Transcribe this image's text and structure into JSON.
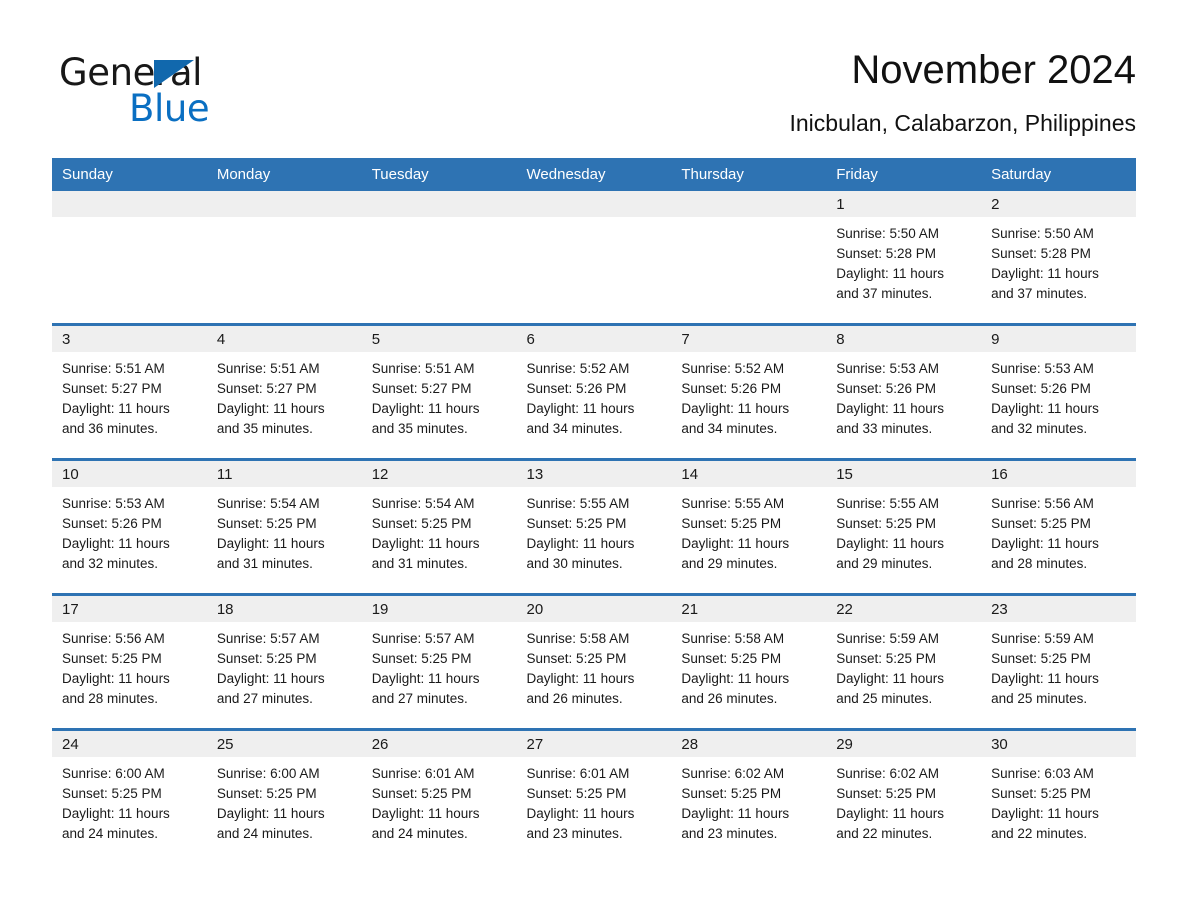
{
  "logo": {
    "word_one": "General",
    "word_two": "Blue",
    "triangle_color": "#1168ad",
    "blue_color": "#0a6fc2"
  },
  "header": {
    "title": "November 2024",
    "subtitle": "Inicbulan, Calabarzon, Philippines"
  },
  "theme": {
    "header_blue": "#2e73b3",
    "row_rule_blue": "#2e73b3",
    "date_band_gray": "#efefef",
    "text_color": "#1a1a1a"
  },
  "weekday_headers": [
    "Sunday",
    "Monday",
    "Tuesday",
    "Wednesday",
    "Thursday",
    "Friday",
    "Saturday"
  ],
  "weeks": [
    [
      {
        "date": "",
        "empty": true
      },
      {
        "date": "",
        "empty": true
      },
      {
        "date": "",
        "empty": true
      },
      {
        "date": "",
        "empty": true
      },
      {
        "date": "",
        "empty": true
      },
      {
        "date": "1",
        "sunrise": "Sunrise: 5:50 AM",
        "sunset": "Sunset: 5:28 PM",
        "daylight": "Daylight: 11 hours and 37 minutes."
      },
      {
        "date": "2",
        "sunrise": "Sunrise: 5:50 AM",
        "sunset": "Sunset: 5:28 PM",
        "daylight": "Daylight: 11 hours and 37 minutes."
      }
    ],
    [
      {
        "date": "3",
        "sunrise": "Sunrise: 5:51 AM",
        "sunset": "Sunset: 5:27 PM",
        "daylight": "Daylight: 11 hours and 36 minutes."
      },
      {
        "date": "4",
        "sunrise": "Sunrise: 5:51 AM",
        "sunset": "Sunset: 5:27 PM",
        "daylight": "Daylight: 11 hours and 35 minutes."
      },
      {
        "date": "5",
        "sunrise": "Sunrise: 5:51 AM",
        "sunset": "Sunset: 5:27 PM",
        "daylight": "Daylight: 11 hours and 35 minutes."
      },
      {
        "date": "6",
        "sunrise": "Sunrise: 5:52 AM",
        "sunset": "Sunset: 5:26 PM",
        "daylight": "Daylight: 11 hours and 34 minutes."
      },
      {
        "date": "7",
        "sunrise": "Sunrise: 5:52 AM",
        "sunset": "Sunset: 5:26 PM",
        "daylight": "Daylight: 11 hours and 34 minutes."
      },
      {
        "date": "8",
        "sunrise": "Sunrise: 5:53 AM",
        "sunset": "Sunset: 5:26 PM",
        "daylight": "Daylight: 11 hours and 33 minutes."
      },
      {
        "date": "9",
        "sunrise": "Sunrise: 5:53 AM",
        "sunset": "Sunset: 5:26 PM",
        "daylight": "Daylight: 11 hours and 32 minutes."
      }
    ],
    [
      {
        "date": "10",
        "sunrise": "Sunrise: 5:53 AM",
        "sunset": "Sunset: 5:26 PM",
        "daylight": "Daylight: 11 hours and 32 minutes."
      },
      {
        "date": "11",
        "sunrise": "Sunrise: 5:54 AM",
        "sunset": "Sunset: 5:25 PM",
        "daylight": "Daylight: 11 hours and 31 minutes."
      },
      {
        "date": "12",
        "sunrise": "Sunrise: 5:54 AM",
        "sunset": "Sunset: 5:25 PM",
        "daylight": "Daylight: 11 hours and 31 minutes."
      },
      {
        "date": "13",
        "sunrise": "Sunrise: 5:55 AM",
        "sunset": "Sunset: 5:25 PM",
        "daylight": "Daylight: 11 hours and 30 minutes."
      },
      {
        "date": "14",
        "sunrise": "Sunrise: 5:55 AM",
        "sunset": "Sunset: 5:25 PM",
        "daylight": "Daylight: 11 hours and 29 minutes."
      },
      {
        "date": "15",
        "sunrise": "Sunrise: 5:55 AM",
        "sunset": "Sunset: 5:25 PM",
        "daylight": "Daylight: 11 hours and 29 minutes."
      },
      {
        "date": "16",
        "sunrise": "Sunrise: 5:56 AM",
        "sunset": "Sunset: 5:25 PM",
        "daylight": "Daylight: 11 hours and 28 minutes."
      }
    ],
    [
      {
        "date": "17",
        "sunrise": "Sunrise: 5:56 AM",
        "sunset": "Sunset: 5:25 PM",
        "daylight": "Daylight: 11 hours and 28 minutes."
      },
      {
        "date": "18",
        "sunrise": "Sunrise: 5:57 AM",
        "sunset": "Sunset: 5:25 PM",
        "daylight": "Daylight: 11 hours and 27 minutes."
      },
      {
        "date": "19",
        "sunrise": "Sunrise: 5:57 AM",
        "sunset": "Sunset: 5:25 PM",
        "daylight": "Daylight: 11 hours and 27 minutes."
      },
      {
        "date": "20",
        "sunrise": "Sunrise: 5:58 AM",
        "sunset": "Sunset: 5:25 PM",
        "daylight": "Daylight: 11 hours and 26 minutes."
      },
      {
        "date": "21",
        "sunrise": "Sunrise: 5:58 AM",
        "sunset": "Sunset: 5:25 PM",
        "daylight": "Daylight: 11 hours and 26 minutes."
      },
      {
        "date": "22",
        "sunrise": "Sunrise: 5:59 AM",
        "sunset": "Sunset: 5:25 PM",
        "daylight": "Daylight: 11 hours and 25 minutes."
      },
      {
        "date": "23",
        "sunrise": "Sunrise: 5:59 AM",
        "sunset": "Sunset: 5:25 PM",
        "daylight": "Daylight: 11 hours and 25 minutes."
      }
    ],
    [
      {
        "date": "24",
        "sunrise": "Sunrise: 6:00 AM",
        "sunset": "Sunset: 5:25 PM",
        "daylight": "Daylight: 11 hours and 24 minutes."
      },
      {
        "date": "25",
        "sunrise": "Sunrise: 6:00 AM",
        "sunset": "Sunset: 5:25 PM",
        "daylight": "Daylight: 11 hours and 24 minutes."
      },
      {
        "date": "26",
        "sunrise": "Sunrise: 6:01 AM",
        "sunset": "Sunset: 5:25 PM",
        "daylight": "Daylight: 11 hours and 24 minutes."
      },
      {
        "date": "27",
        "sunrise": "Sunrise: 6:01 AM",
        "sunset": "Sunset: 5:25 PM",
        "daylight": "Daylight: 11 hours and 23 minutes."
      },
      {
        "date": "28",
        "sunrise": "Sunrise: 6:02 AM",
        "sunset": "Sunset: 5:25 PM",
        "daylight": "Daylight: 11 hours and 23 minutes."
      },
      {
        "date": "29",
        "sunrise": "Sunrise: 6:02 AM",
        "sunset": "Sunset: 5:25 PM",
        "daylight": "Daylight: 11 hours and 22 minutes."
      },
      {
        "date": "30",
        "sunrise": "Sunrise: 6:03 AM",
        "sunset": "Sunset: 5:25 PM",
        "daylight": "Daylight: 11 hours and 22 minutes."
      }
    ]
  ]
}
